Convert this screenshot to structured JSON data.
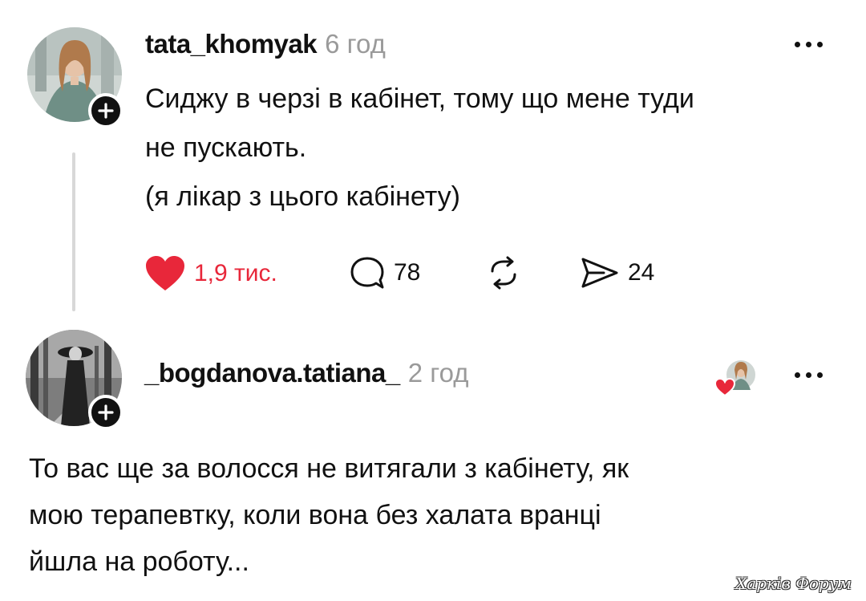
{
  "colors": {
    "like_red": "#e8273a",
    "muted": "#9a9a9a",
    "text": "#111111"
  },
  "post1": {
    "username": "tata_khomyak",
    "time": "6 год",
    "lines": [
      "Сиджу в черзі в кабінет, тому що мене туди",
      "не пускають.",
      "(я лікар з цього кабінету)"
    ],
    "likes": "1,9 тис.",
    "comments": "78",
    "shares": "24",
    "icons": [
      "heart-filled-icon",
      "comment-icon",
      "repost-icon",
      "send-icon",
      "more-icon",
      "plus-icon"
    ]
  },
  "post2": {
    "username": "_bogdanova.tatiana_",
    "time": "2 год",
    "lines": [
      "То вас ще за волосся не витягали з кабінету, як",
      "мою терапевтку, коли вона без халата вранці",
      "йшла на роботу..."
    ],
    "icons": [
      "liked-by-author-icon",
      "more-icon",
      "plus-icon"
    ]
  },
  "watermark": "Харків Форум"
}
